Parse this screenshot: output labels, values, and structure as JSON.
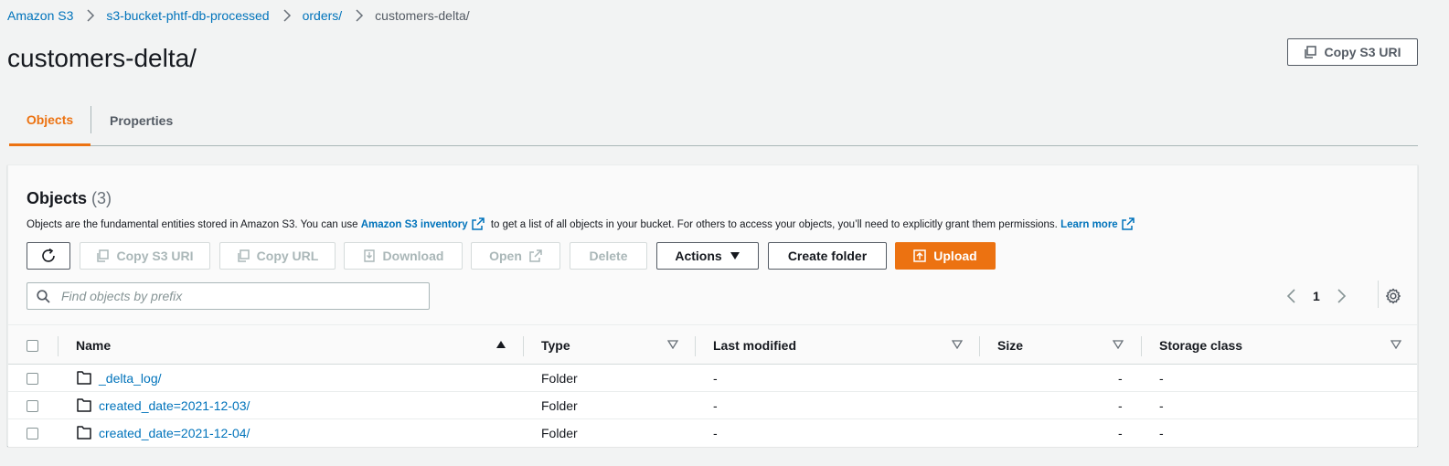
{
  "breadcrumb": [
    "Amazon S3",
    "s3-bucket-phtf-db-processed",
    "orders/",
    "customers-delta/"
  ],
  "page_title": "customers-delta/",
  "header_buttons": {
    "copy_s3_uri": "Copy S3 URI"
  },
  "tabs": [
    {
      "label": "Objects",
      "active": true
    },
    {
      "label": "Properties",
      "active": false
    }
  ],
  "objects_panel": {
    "title": "Objects",
    "count": "(3)",
    "description_before": "Objects are the fundamental entities stored in Amazon S3. You can use",
    "description_link": "Amazon S3 inventory",
    "description_middle": "to get a list of all objects in your bucket. For others to access your objects, you’ll need to explicitly grant them permissions.",
    "learn_more": "Learn more"
  },
  "toolbar": {
    "refresh_icon": "refresh-icon",
    "copy_s3_uri": "Copy S3 URI",
    "copy_url": "Copy URL",
    "download": "Download",
    "open": "Open",
    "delete": "Delete",
    "actions": "Actions",
    "create_folder": "Create folder",
    "upload": "Upload"
  },
  "search": {
    "placeholder": "Find objects by prefix",
    "value": ""
  },
  "pagination": {
    "current_page": "1"
  },
  "table": {
    "columns": [
      "Name",
      "Type",
      "Last modified",
      "Size",
      "Storage class"
    ],
    "rows": [
      {
        "name": "_delta_log/",
        "type": "Folder",
        "last_modified": "-",
        "size": "-",
        "storage_class": "-"
      },
      {
        "name": "created_date=2021-12-03/",
        "type": "Folder",
        "last_modified": "-",
        "size": "-",
        "storage_class": "-"
      },
      {
        "name": "created_date=2021-12-04/",
        "type": "Folder",
        "last_modified": "-",
        "size": "-",
        "storage_class": "-"
      }
    ]
  },
  "colors": {
    "link": "#0073bb",
    "accent": "#ec7211",
    "text": "#16191f",
    "muted": "#545b64",
    "disabled": "#aab7b8",
    "background": "#f2f3f3"
  }
}
